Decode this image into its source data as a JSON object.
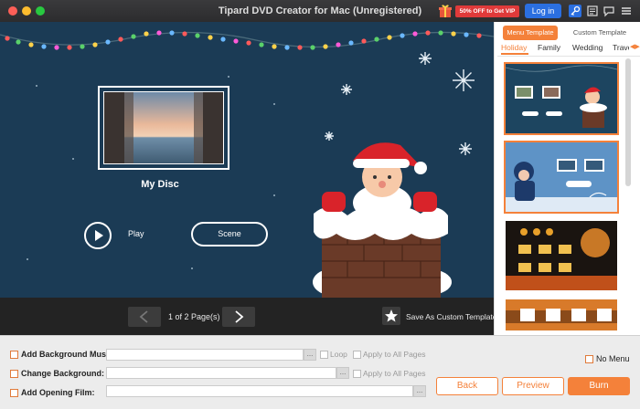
{
  "window": {
    "title": "Tipard DVD Creator for Mac (Unregistered)"
  },
  "toolbar": {
    "promo_label": "50% OFF to Get VIP",
    "login_label": "Log in"
  },
  "preview": {
    "disc_title": "My Disc",
    "play_label": "Play",
    "scene_label": "Scene",
    "page_info": "1 of 2 Page(s)",
    "save_template_label": "Save As Custom Template"
  },
  "panel": {
    "tabs": [
      {
        "label": "Menu Template",
        "active": true
      },
      {
        "label": "Custom Template",
        "active": false
      }
    ],
    "categories": [
      {
        "label": "Holiday",
        "active": true
      },
      {
        "label": "Family",
        "active": false
      },
      {
        "label": "Wedding",
        "active": false
      },
      {
        "label": "Trave",
        "active": false
      }
    ]
  },
  "settings": {
    "bg_music_label": "Add Background Music:",
    "bg_music_value": "",
    "loop_label": "Loop",
    "apply_all_1": "Apply to All Pages",
    "change_bg_label": "Change Background:",
    "change_bg_value": "",
    "apply_all_2": "Apply to All Pages",
    "opening_film_label": "Add Opening Film:",
    "opening_film_value": "",
    "no_menu_label": "No Menu",
    "dots": "..."
  },
  "actions": {
    "back_label": "Back",
    "preview_label": "Preview",
    "burn_label": "Burn"
  },
  "colors": {
    "accent": "#f4813a",
    "preview_bg": "#1b3b55",
    "login_blue": "#2b6fe0",
    "promo_red": "#e03a3a"
  }
}
